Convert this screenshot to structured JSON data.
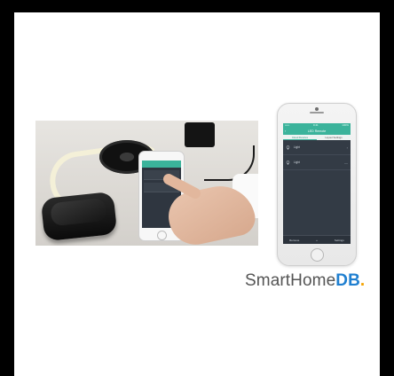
{
  "photo": {
    "description_icons": [
      "led-strip-reel",
      "power-adapter",
      "smart-hub",
      "smartphone",
      "hand"
    ]
  },
  "phone": {
    "status": {
      "carrier": "••••• ",
      "time": "9:41",
      "battery": "100%"
    },
    "title": "LED Remote",
    "back_icon": "chevron-left-icon",
    "tabs": [
      {
        "label": "Cloud Devices",
        "active": true
      },
      {
        "label": "Layout Settings",
        "active": false
      }
    ],
    "items": [
      {
        "label": "Light",
        "icon": "bulb-icon"
      },
      {
        "label": "Light",
        "icon": "bulb-icon"
      }
    ],
    "bottom": {
      "left": "Remove",
      "center": "+",
      "right": "Settings"
    }
  },
  "logo": {
    "part1": "SmartHome",
    "part2": "DB",
    "part3": "."
  },
  "colors": {
    "accent": "#3bb39b",
    "screen": "#333b45",
    "logo_db": "#1f7fd0",
    "logo_dot": "#f4a300"
  }
}
